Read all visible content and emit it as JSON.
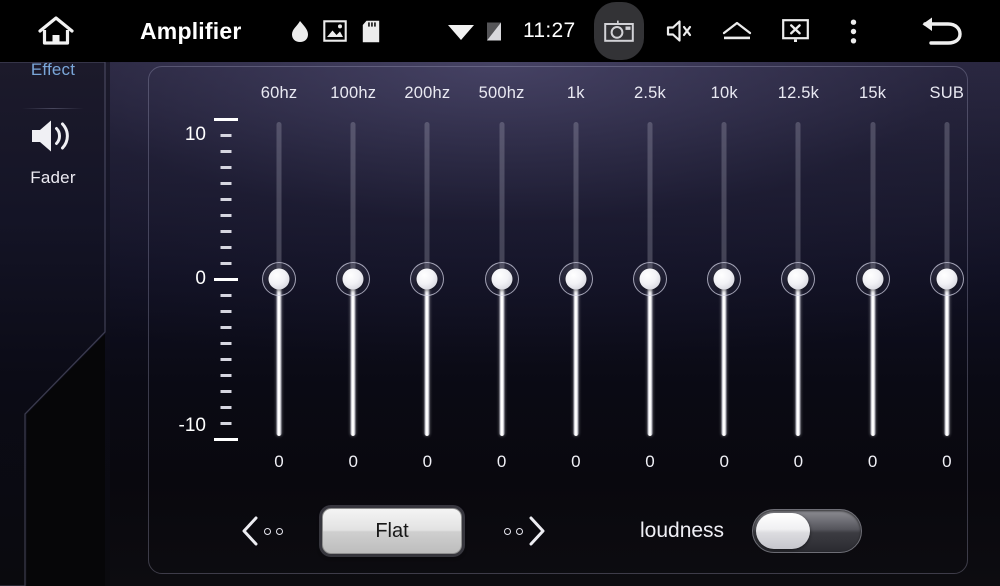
{
  "statusbar": {
    "app_title": "Amplifier",
    "clock": "11:27",
    "icons": {
      "home": "home-icon",
      "bluetooth": "bluetooth-icon",
      "gallery": "gallery-icon",
      "sdcard": "sdcard-icon",
      "wifi": "wifi-icon",
      "signal": "signal-off-icon",
      "camera": "camera-icon",
      "mute": "volume-mute-icon",
      "eject": "eject-icon",
      "screenoff": "screen-off-icon",
      "overflow": "overflow-menu-icon",
      "back": "back-arrow-icon"
    }
  },
  "sidebar": {
    "items": [
      {
        "label": "Effect",
        "icon": "equalizer-icon",
        "selected": true
      },
      {
        "label": "Fader",
        "icon": "speaker-icon",
        "selected": false
      }
    ]
  },
  "equalizer": {
    "scale": {
      "top_label": "10",
      "mid_label": "0",
      "bottom_label": "-10",
      "max": 10,
      "min": -10,
      "minor_ticks_per_half": 9
    },
    "bands": [
      {
        "label": "60hz",
        "value": "0"
      },
      {
        "label": "100hz",
        "value": "0"
      },
      {
        "label": "200hz",
        "value": "0"
      },
      {
        "label": "500hz",
        "value": "0"
      },
      {
        "label": "1k",
        "value": "0"
      },
      {
        "label": "2.5k",
        "value": "0"
      },
      {
        "label": "10k",
        "value": "0"
      },
      {
        "label": "12.5k",
        "value": "0"
      },
      {
        "label": "15k",
        "value": "0"
      },
      {
        "label": "SUB",
        "value": "0"
      }
    ]
  },
  "controls": {
    "preset": "Flat",
    "prev_preset_icon": "chevron-left-icon",
    "next_preset_icon": "chevron-right-icon",
    "loudness_label": "loudness",
    "loudness_on": false
  },
  "colors": {
    "accent": "#7aa6d8",
    "text": "#ffffff",
    "panel_border": "#afafcd",
    "slider_fill": "#ffffff",
    "background_top": "#2b2840",
    "background_bottom": "#0d0c10"
  }
}
